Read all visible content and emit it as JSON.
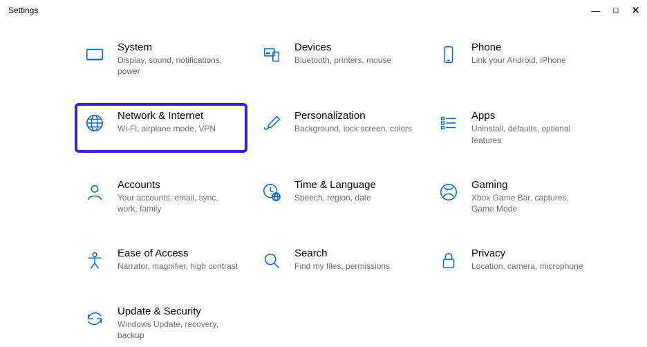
{
  "window": {
    "title": "Settings"
  },
  "tiles": {
    "system": {
      "title": "System",
      "desc": "Display, sound, notifications, power"
    },
    "devices": {
      "title": "Devices",
      "desc": "Bluetooth, printers, mouse"
    },
    "phone": {
      "title": "Phone",
      "desc": "Link your Android, iPhone"
    },
    "network": {
      "title": "Network & Internet",
      "desc": "Wi-Fi, airplane mode, VPN"
    },
    "personal": {
      "title": "Personalization",
      "desc": "Background, lock screen, colors"
    },
    "apps": {
      "title": "Apps",
      "desc": "Uninstall, defaults, optional features"
    },
    "accounts": {
      "title": "Accounts",
      "desc": "Your accounts, email, sync, work, family"
    },
    "time": {
      "title": "Time & Language",
      "desc": "Speech, region, date"
    },
    "gaming": {
      "title": "Gaming",
      "desc": "Xbox Game Bar, captures, Game Mode"
    },
    "ease": {
      "title": "Ease of Access",
      "desc": "Narrator, magnifier, high contrast"
    },
    "search": {
      "title": "Search",
      "desc": "Find my files, permissions"
    },
    "privacy": {
      "title": "Privacy",
      "desc": "Location, camera, microphone"
    },
    "update": {
      "title": "Update & Security",
      "desc": "Windows Update, recovery, backup"
    }
  },
  "highlighted": "network"
}
